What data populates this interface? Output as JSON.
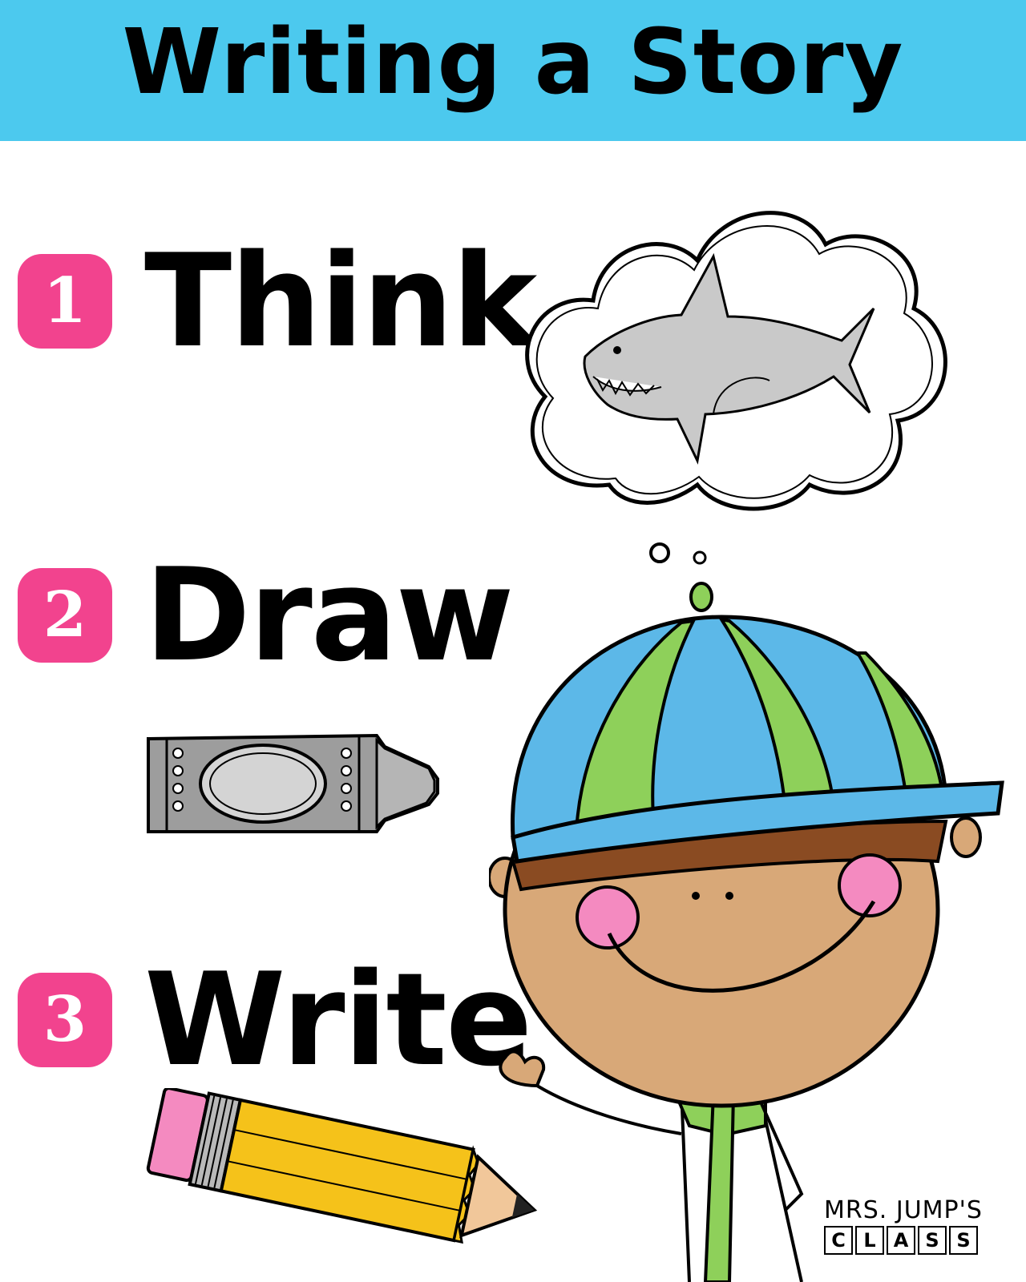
{
  "banner": {
    "title": "Writing a Story",
    "color": "#4cc9ee"
  },
  "steps": [
    {
      "number": "1",
      "word": "Think"
    },
    {
      "number": "2",
      "word": "Draw"
    },
    {
      "number": "3",
      "word": "Write"
    }
  ],
  "badge_color": "#f2438e",
  "illustrations": [
    "thought-cloud",
    "shark",
    "gray-crayon",
    "yellow-pencil",
    "boy-in-propeller-cap"
  ],
  "logo": {
    "line1": "MRS. JUMP'S",
    "letters": [
      "C",
      "L",
      "A",
      "S",
      "S"
    ]
  }
}
